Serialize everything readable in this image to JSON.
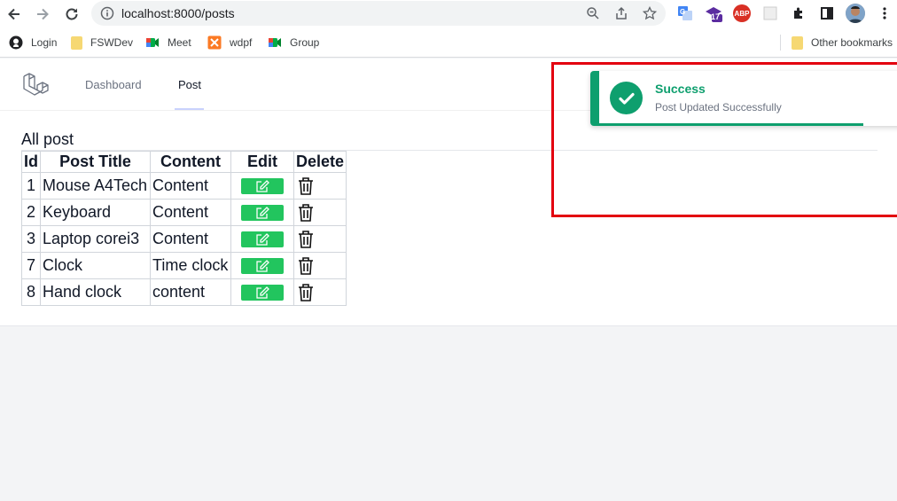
{
  "browser": {
    "url": "localhost:8000/posts",
    "extension_badge": "17",
    "abp_label": "ABP",
    "bookmarks": [
      "Login",
      "FSWDev",
      "Meet",
      "wdpf",
      "Group"
    ],
    "other_bookmarks": "Other bookmarks"
  },
  "nav": {
    "links": [
      "Dashboard",
      "Post"
    ],
    "active": "Post"
  },
  "page": {
    "section_title": "All post"
  },
  "table": {
    "headers": [
      "Id",
      "Post Title",
      "Content",
      "Edit",
      "Delete"
    ],
    "rows": [
      {
        "id": "1",
        "title": "Mouse A4Tech",
        "content": "Content"
      },
      {
        "id": "2",
        "title": "Keyboard",
        "content": "Content"
      },
      {
        "id": "3",
        "title": "Laptop corei3",
        "content": "Content"
      },
      {
        "id": "7",
        "title": "Clock",
        "content": "Time clock"
      },
      {
        "id": "8",
        "title": "Hand clock",
        "content": "content"
      }
    ]
  },
  "toast": {
    "title": "Success",
    "message": "Post Updated Successfully",
    "progress": 0.83
  },
  "colors": {
    "success": "#0e9f6e",
    "edit_button": "#22c55e",
    "highlight_frame": "#e3000f"
  },
  "icons": {
    "back": "arrow-left-icon",
    "forward": "arrow-right-icon",
    "reload": "reload-icon",
    "edit": "pencil-square-icon",
    "delete": "trash-icon",
    "toast": "check-circle-icon"
  }
}
